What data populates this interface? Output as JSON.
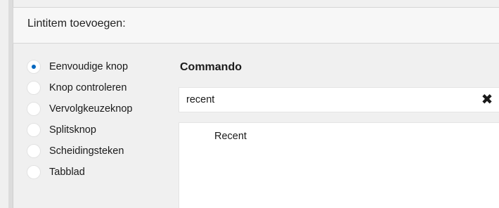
{
  "header": {
    "title": "Lintitem toevoegen:"
  },
  "item_types": [
    {
      "label": "Eenvoudige knop",
      "selected": true
    },
    {
      "label": "Knop controleren",
      "selected": false
    },
    {
      "label": "Vervolgkeuzeknop",
      "selected": false
    },
    {
      "label": "Splitsknop",
      "selected": false
    },
    {
      "label": "Scheidingsteken",
      "selected": false
    },
    {
      "label": "Tabblad",
      "selected": false
    }
  ],
  "command": {
    "heading": "Commando",
    "search_value": "recent",
    "clear_glyph": "✖",
    "results": [
      "Recent"
    ]
  },
  "colors": {
    "accent": "#0067c0",
    "background": "#f0f0f0"
  }
}
